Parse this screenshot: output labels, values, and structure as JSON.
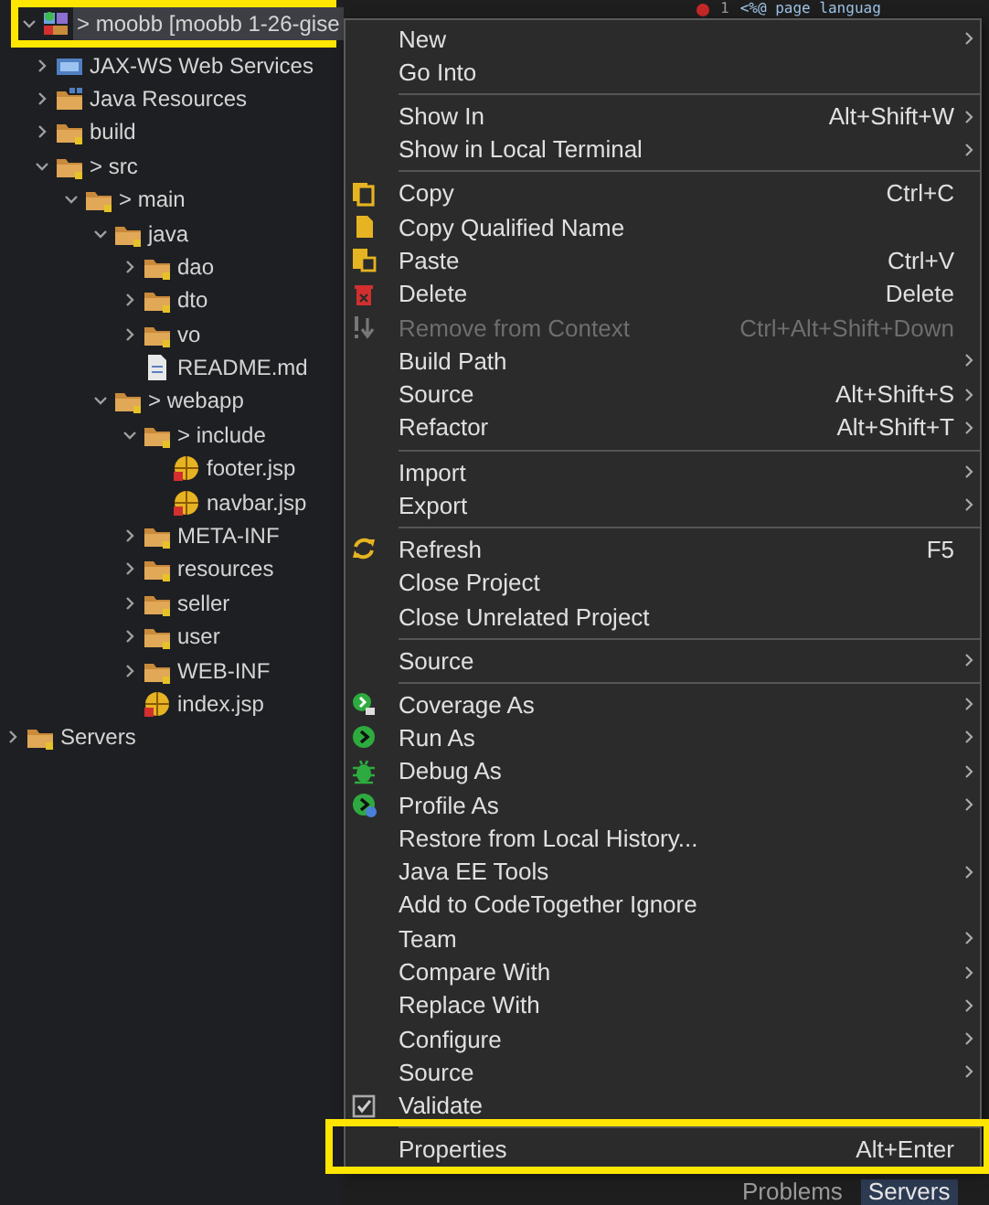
{
  "tree": [
    {
      "label": "> moobb [moobb 1-26-gise",
      "kind": "project",
      "expanded": true,
      "selected": true,
      "highlighted": true,
      "children": [
        {
          "label": "JAX-WS Web Services",
          "kind": "services",
          "expanded": false,
          "selected": false,
          "highlighted": false
        },
        {
          "label": "Java Resources",
          "kind": "library",
          "expanded": false,
          "selected": false,
          "highlighted": false
        },
        {
          "label": "build",
          "kind": "folder",
          "expanded": false,
          "selected": false,
          "highlighted": false
        },
        {
          "label": "> src",
          "kind": "folder",
          "expanded": true,
          "selected": false,
          "highlighted": false,
          "children": [
            {
              "label": "> main",
              "kind": "folder",
              "expanded": true,
              "selected": false,
              "highlighted": false,
              "children": [
                {
                  "label": "java",
                  "kind": "folder",
                  "expanded": true,
                  "selected": false,
                  "highlighted": false,
                  "children": [
                    {
                      "label": "dao",
                      "kind": "folder",
                      "expanded": false,
                      "selected": false,
                      "highlighted": false
                    },
                    {
                      "label": "dto",
                      "kind": "folder",
                      "expanded": false,
                      "selected": false,
                      "highlighted": false
                    },
                    {
                      "label": "vo",
                      "kind": "folder",
                      "expanded": false,
                      "selected": false,
                      "highlighted": false
                    },
                    {
                      "label": "README.md",
                      "kind": "file",
                      "selected": false,
                      "highlighted": false
                    }
                  ]
                },
                {
                  "label": "> webapp",
                  "kind": "folder",
                  "expanded": true,
                  "selected": false,
                  "highlighted": false,
                  "children": [
                    {
                      "label": "> include",
                      "kind": "folder",
                      "expanded": true,
                      "selected": false,
                      "highlighted": false,
                      "children": [
                        {
                          "label": "footer.jsp",
                          "kind": "web-page",
                          "selected": false,
                          "highlighted": false
                        },
                        {
                          "label": "navbar.jsp",
                          "kind": "web-page",
                          "selected": false,
                          "highlighted": false
                        }
                      ]
                    },
                    {
                      "label": "META-INF",
                      "kind": "folder",
                      "expanded": false,
                      "selected": false,
                      "highlighted": false
                    },
                    {
                      "label": "resources",
                      "kind": "folder",
                      "expanded": false,
                      "selected": false,
                      "highlighted": false
                    },
                    {
                      "label": "seller",
                      "kind": "folder",
                      "expanded": false,
                      "selected": false,
                      "highlighted": false
                    },
                    {
                      "label": "user",
                      "kind": "folder",
                      "expanded": false,
                      "selected": false,
                      "highlighted": false
                    },
                    {
                      "label": "WEB-INF",
                      "kind": "folder",
                      "expanded": false,
                      "selected": false,
                      "highlighted": false
                    },
                    {
                      "label": "index.jsp",
                      "kind": "web-page",
                      "selected": false,
                      "highlighted": false
                    }
                  ]
                }
              ]
            }
          ]
        }
      ]
    },
    {
      "label": "Servers",
      "kind": "folder",
      "expanded": false,
      "selected": false,
      "highlighted": false
    }
  ],
  "editor": {
    "line_number": "1",
    "code": "<%@ page languag"
  },
  "bottom_tabs": [
    {
      "label": "Problems",
      "selected": false
    },
    {
      "label": "Servers",
      "selected": true
    }
  ],
  "context_menu": [
    {
      "kind": "item",
      "label": "New",
      "submenu": true,
      "disabled": false,
      "highlighted": false
    },
    {
      "kind": "item",
      "label": "Go Into",
      "submenu": false,
      "disabled": false,
      "highlighted": false
    },
    {
      "kind": "separator"
    },
    {
      "kind": "item",
      "label": "Show In",
      "shortcut": "Alt+Shift+W",
      "submenu": true,
      "disabled": false,
      "highlighted": false
    },
    {
      "kind": "item",
      "label": "Show in Local Terminal",
      "submenu": true,
      "disabled": false,
      "highlighted": false
    },
    {
      "kind": "separator"
    },
    {
      "kind": "item",
      "label": "Copy",
      "shortcut": "Ctrl+C",
      "submenu": false,
      "disabled": false,
      "highlighted": false
    },
    {
      "kind": "item",
      "label": "Copy Qualified Name",
      "submenu": false,
      "disabled": false,
      "highlighted": false
    },
    {
      "kind": "item",
      "label": "Paste",
      "shortcut": "Ctrl+V",
      "submenu": false,
      "disabled": false,
      "highlighted": false
    },
    {
      "kind": "item",
      "label": "Delete",
      "shortcut": "Delete",
      "submenu": false,
      "disabled": false,
      "highlighted": false
    },
    {
      "kind": "item",
      "label": "Remove from Context",
      "shortcut": "Ctrl+Alt+Shift+Down",
      "submenu": false,
      "disabled": true,
      "highlighted": false
    },
    {
      "kind": "item",
      "label": "Build Path",
      "submenu": true,
      "disabled": false,
      "highlighted": false
    },
    {
      "kind": "item",
      "label": "Source",
      "shortcut": "Alt+Shift+S",
      "submenu": true,
      "disabled": false,
      "highlighted": false
    },
    {
      "kind": "item",
      "label": "Refactor",
      "shortcut": "Alt+Shift+T",
      "submenu": true,
      "disabled": false,
      "highlighted": false
    },
    {
      "kind": "separator"
    },
    {
      "kind": "item",
      "label": "Import",
      "submenu": true,
      "disabled": false,
      "highlighted": false
    },
    {
      "kind": "item",
      "label": "Export",
      "submenu": true,
      "disabled": false,
      "highlighted": false
    },
    {
      "kind": "separator"
    },
    {
      "kind": "item",
      "label": "Refresh",
      "shortcut": "F5",
      "submenu": false,
      "disabled": false,
      "highlighted": false
    },
    {
      "kind": "item",
      "label": "Close Project",
      "submenu": false,
      "disabled": false,
      "highlighted": false
    },
    {
      "kind": "item",
      "label": "Close Unrelated Project",
      "submenu": false,
      "disabled": false,
      "highlighted": false
    },
    {
      "kind": "separator"
    },
    {
      "kind": "item",
      "label": "Source",
      "submenu": true,
      "disabled": false,
      "highlighted": false
    },
    {
      "kind": "separator"
    },
    {
      "kind": "item",
      "label": "Coverage As",
      "submenu": true,
      "disabled": false,
      "highlighted": false
    },
    {
      "kind": "item",
      "label": "Run As",
      "submenu": true,
      "disabled": false,
      "highlighted": false
    },
    {
      "kind": "item",
      "label": "Debug As",
      "submenu": true,
      "disabled": false,
      "highlighted": false
    },
    {
      "kind": "item",
      "label": "Profile As",
      "submenu": true,
      "disabled": false,
      "highlighted": false
    },
    {
      "kind": "item",
      "label": "Restore from Local History...",
      "submenu": false,
      "disabled": false,
      "highlighted": false
    },
    {
      "kind": "item",
      "label": "Java EE Tools",
      "submenu": true,
      "disabled": false,
      "highlighted": false
    },
    {
      "kind": "item",
      "label": "Add to CodeTogether Ignore",
      "submenu": false,
      "disabled": false,
      "highlighted": false
    },
    {
      "kind": "item",
      "label": "Team",
      "submenu": true,
      "disabled": false,
      "highlighted": false
    },
    {
      "kind": "item",
      "label": "Compare With",
      "submenu": true,
      "disabled": false,
      "highlighted": false
    },
    {
      "kind": "item",
      "label": "Replace With",
      "submenu": true,
      "disabled": false,
      "highlighted": false
    },
    {
      "kind": "item",
      "label": "Configure",
      "submenu": true,
      "disabled": false,
      "highlighted": false
    },
    {
      "kind": "item",
      "label": "Source",
      "submenu": true,
      "disabled": false,
      "highlighted": false
    },
    {
      "kind": "item",
      "label": "Validate",
      "submenu": false,
      "disabled": false,
      "highlighted": false
    },
    {
      "kind": "separator"
    },
    {
      "kind": "item",
      "label": "Properties",
      "shortcut": "Alt+Enter",
      "submenu": false,
      "disabled": false,
      "highlighted": true
    }
  ]
}
